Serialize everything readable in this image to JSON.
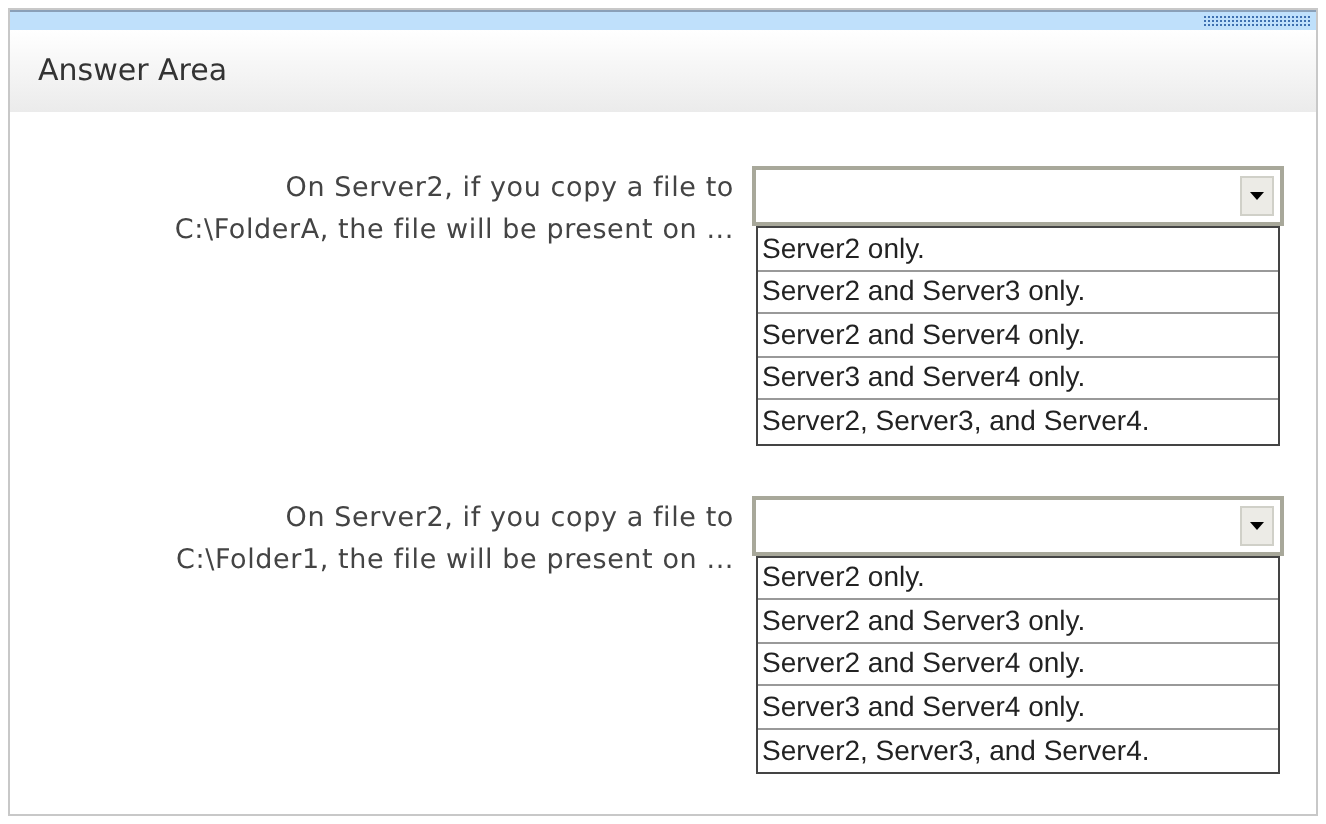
{
  "header": {
    "title": "Answer Area"
  },
  "questions": [
    {
      "label_lines": [
        "On Server2, if you copy a file to",
        "C:\\FolderA, the file will be present on ..."
      ],
      "options": [
        {
          "label": "Server2 only.",
          "selected": false
        },
        {
          "label": "Server2 and Server3 only.",
          "selected": false
        },
        {
          "label": "Server2 and Server4 only.",
          "selected": false
        },
        {
          "label": "Server3 and Server4 only.",
          "selected": false
        },
        {
          "label": "Server2, Server3, and Server4.",
          "selected": false
        }
      ]
    },
    {
      "label_lines": [
        "On Server2, if you copy a file to",
        "C:\\Folder1, the file will be present on ..."
      ],
      "options": [
        {
          "label": "Server2 only.",
          "selected": false
        },
        {
          "label": "Server2 and Server3 only.",
          "selected": false
        },
        {
          "label": "Server2 and Server4 only.",
          "selected": false
        },
        {
          "label": "Server3 and Server4 only.",
          "selected": false
        },
        {
          "label": "Server2, Server3, and Server4.",
          "selected": false
        }
      ]
    }
  ]
}
